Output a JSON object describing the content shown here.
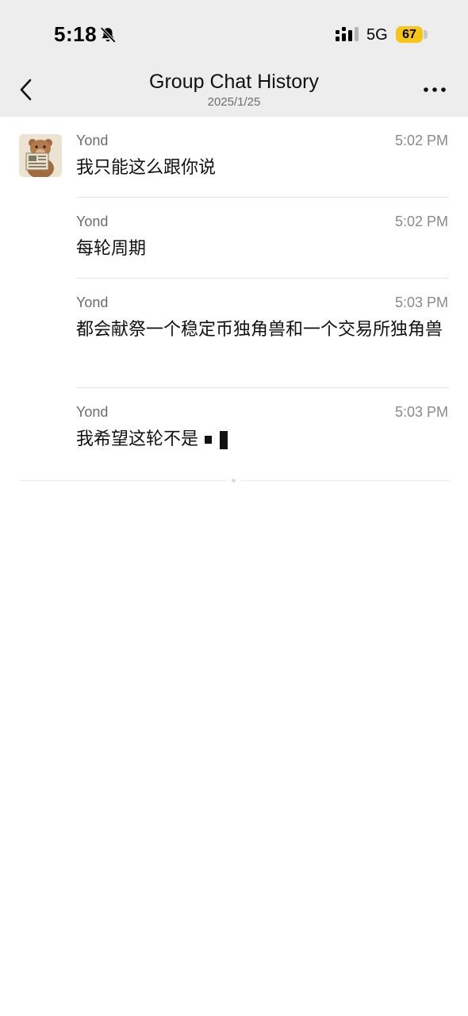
{
  "status_bar": {
    "time": "5:18",
    "network": "5G",
    "battery": "67",
    "icons": [
      "bell-slash-icon",
      "signal-icon"
    ]
  },
  "nav": {
    "title": "Group Chat History",
    "subtitle": "2025/1/25",
    "icons": [
      "back-arrow-icon",
      "more-icon"
    ]
  },
  "messages": [
    {
      "sender": "Yond",
      "time": "5:02 PM",
      "text": "我只能这么跟你说"
    },
    {
      "sender": "Yond",
      "time": "5:02 PM",
      "text": "每轮周期"
    },
    {
      "sender": "Yond",
      "time": "5:03 PM",
      "text": "都会献祭一个稳定币独角兽和一个交易所独角兽"
    },
    {
      "sender": "Yond",
      "time": "5:03 PM",
      "text": "我希望这轮不是"
    }
  ],
  "colors": {
    "header_bg": "#ededed",
    "battery_yellow": "#f5c518",
    "secondary_text": "#6d6d6d"
  }
}
